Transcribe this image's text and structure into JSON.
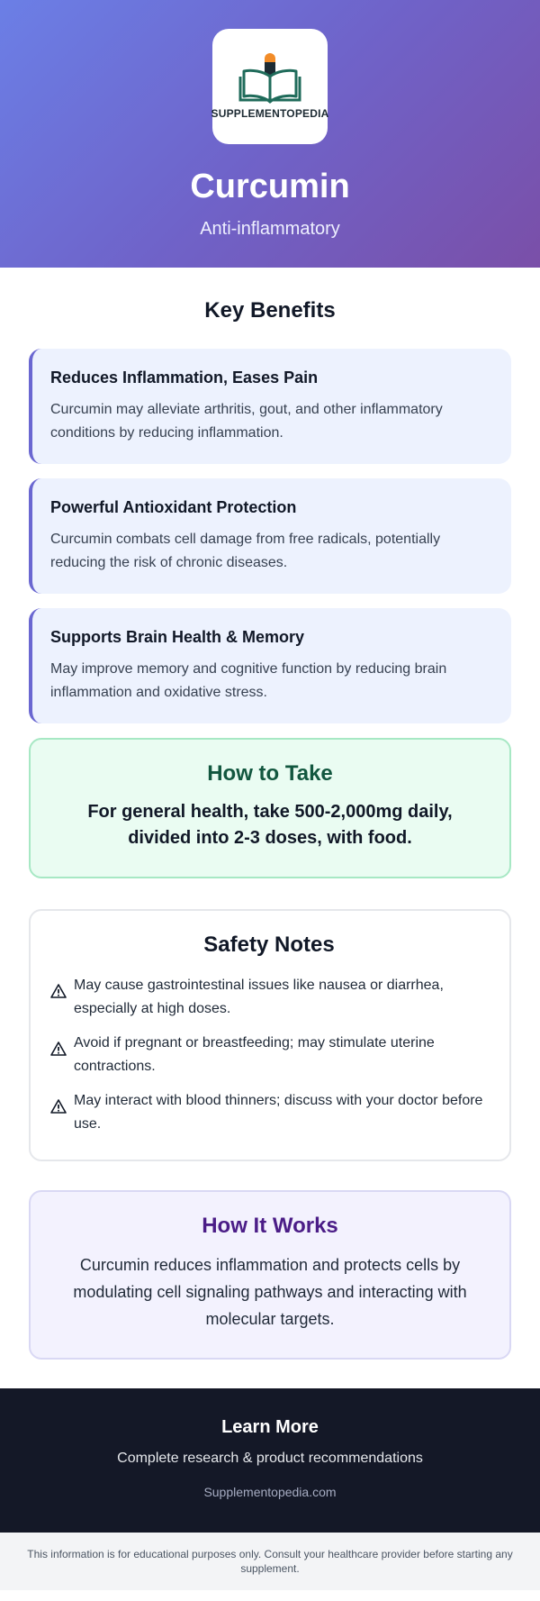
{
  "hero": {
    "logo_text": "SUPPLEMENTOPEDIA",
    "title": "Curcumin",
    "subtitle": "Anti-inflammatory"
  },
  "benefits": {
    "title": "Key Benefits",
    "items": [
      {
        "title": "Reduces Inflammation, Eases Pain",
        "desc": "Curcumin may alleviate arthritis, gout, and other inflammatory conditions by reducing inflammation."
      },
      {
        "title": "Powerful Antioxidant Protection",
        "desc": "Curcumin combats cell damage from free radicals, potentially reducing the risk of chronic diseases."
      },
      {
        "title": "Supports Brain Health & Memory",
        "desc": "May improve memory and cognitive function by reducing brain inflammation and oxidative stress."
      }
    ]
  },
  "how_to_take": {
    "title": "How to Take",
    "text": "For general health, take 500-2,000mg daily, divided into 2-3 doses, with food."
  },
  "safety": {
    "title": "Safety Notes",
    "icon": "warning-icon",
    "items": [
      "May cause gastrointestinal issues like nausea or diarrhea, especially at high doses.",
      "Avoid if pregnant or breastfeeding; may stimulate uterine contractions.",
      "May interact with blood thinners; discuss with your doctor before use."
    ]
  },
  "how_it_works": {
    "title": "How It Works",
    "text": "Curcumin reduces inflammation and protects cells by modulating cell signaling pathways and interacting with molecular targets."
  },
  "footer": {
    "title": "Learn More",
    "subtitle": "Complete research & product recommendations",
    "link": "Supplementopedia.com"
  },
  "disclaimer": "This information is for educational purposes only. Consult your healthcare provider before starting any supplement.",
  "colors": {
    "hero_start": "#6b7fe6",
    "hero_end": "#7a4fa8",
    "benefit_accent": "#6a67d1",
    "howto_title": "#12573f",
    "works_title": "#4b1d87",
    "footer_bg": "#141827"
  }
}
